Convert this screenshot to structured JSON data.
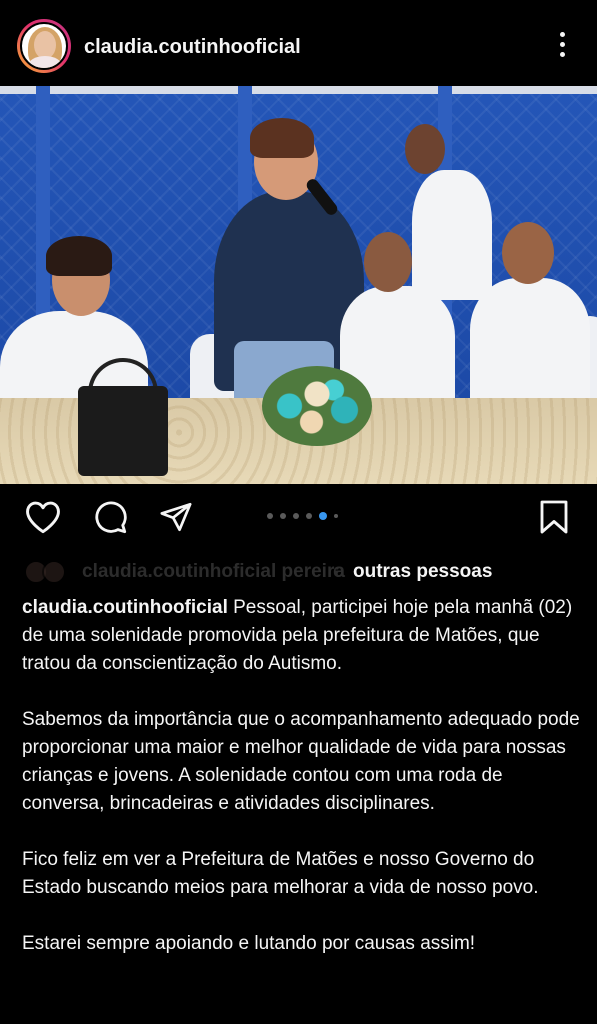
{
  "post": {
    "username": "claudia.coutinhooficial",
    "more_icon": "more-vertical-icon"
  },
  "actions": {
    "like_icon": "heart-icon",
    "comment_icon": "comment-icon",
    "share_icon": "send-icon",
    "save_icon": "bookmark-icon",
    "carousel_count": 6,
    "carousel_active": 4
  },
  "likes": {
    "faded_text": "claudia.coutinhoficial pereira",
    "connector": "e",
    "others_label": "outras pessoas"
  },
  "caption": {
    "username": "claudia.coutinhooficial",
    "paragraph1": " Pessoal, participei hoje pela manhã (02) de uma solenidade promovida pela prefeitura de Matões, que tratou da conscientização do Autismo.",
    "paragraph2": "Sabemos da importância que o acompanhamento adequado pode proporcionar uma maior e melhor qualidade de vida para nossas crianças e jovens. A solenidade contou com uma roda de conversa, brincadeiras e atividades disciplinares.",
    "paragraph3": "Fico feliz em ver a Prefeitura de Matões e nosso Governo do Estado buscando meios para melhorar a vida de nosso povo.",
    "paragraph4": "Estarei sempre apoiando e lutando por causas assim!"
  },
  "colors": {
    "background": "#000000",
    "text": "#f5f5f5",
    "dot_active": "#3897f0",
    "dot_inactive": "#5a5a5a"
  }
}
